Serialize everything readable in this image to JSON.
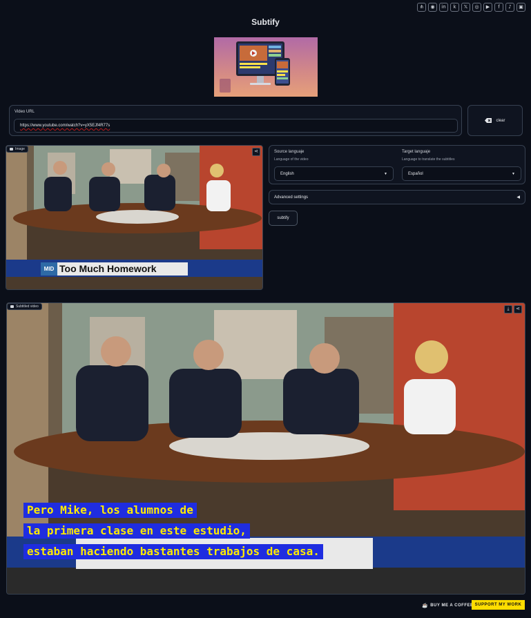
{
  "social_icons": [
    {
      "name": "sitemap-icon",
      "glyph": "⋔"
    },
    {
      "name": "github-icon",
      "glyph": "◉"
    },
    {
      "name": "linkedin-icon",
      "glyph": "in"
    },
    {
      "name": "kaggle-icon",
      "glyph": "k"
    },
    {
      "name": "x-icon",
      "glyph": "𝕏"
    },
    {
      "name": "instagram-icon",
      "glyph": "◎"
    },
    {
      "name": "youtube-icon",
      "glyph": "▶"
    },
    {
      "name": "facebook-icon",
      "glyph": "f"
    },
    {
      "name": "tiktok-icon",
      "glyph": "♪"
    },
    {
      "name": "twitch-icon",
      "glyph": "▣"
    }
  ],
  "app": {
    "title": "Subtify"
  },
  "url_field": {
    "label": "Video URL",
    "value": "https://www.youtube.com/watch?v=yX5EJf4R77s"
  },
  "clear_button": {
    "label": "clear"
  },
  "image_panel": {
    "label": "Image",
    "lower_third": "Too Much Homework",
    "lower_logo": "MID"
  },
  "source_language": {
    "label": "Source languaje",
    "help": "Language of the video",
    "value": "English"
  },
  "target_language": {
    "label": "Target languaje",
    "help": "Language to translate the subtitles",
    "value": "Español"
  },
  "advanced": {
    "label": "Advanced settings"
  },
  "subtify_button": {
    "label": "subtify"
  },
  "video_panel": {
    "label": "Subtitled video",
    "subtitles": [
      "Pero Mike, los alumnos de",
      "la primera clase en este estudio,",
      "estaban haciendo bastantes trabajos de casa."
    ]
  },
  "footer": {
    "coffee": "BUY ME A COFFEE",
    "support": "SUPPORT MY WORK"
  },
  "colors": {
    "background": "#0b0f19",
    "subtitle_bg": "#1f2de0",
    "subtitle_text": "#ffeb00",
    "support_bg": "#ffdd00"
  }
}
